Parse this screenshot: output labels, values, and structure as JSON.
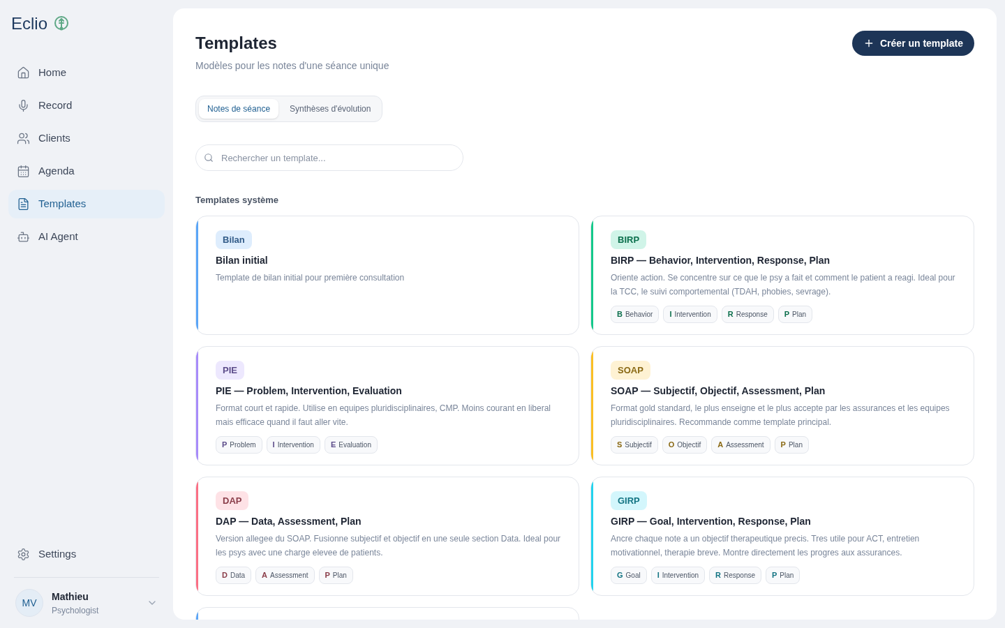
{
  "brand": {
    "name": "Eclio"
  },
  "nav": [
    {
      "label": "Home",
      "kind": "home",
      "selected": false
    },
    {
      "label": "Record",
      "kind": "mic",
      "selected": false
    },
    {
      "label": "Clients",
      "kind": "users",
      "selected": false
    },
    {
      "label": "Agenda",
      "kind": "calendar",
      "selected": false
    },
    {
      "label": "Templates",
      "kind": "file",
      "selected": true
    },
    {
      "label": "AI Agent",
      "kind": "bot",
      "selected": false
    }
  ],
  "settings": {
    "label": "Settings"
  },
  "user": {
    "initials": "MV",
    "name": "Mathieu",
    "role": "Psychologist"
  },
  "page": {
    "title": "Templates",
    "subtitle": "Modèles pour les notes d'une séance unique",
    "create_button": "Créer un template"
  },
  "tabs": [
    {
      "label": "Notes de séance",
      "selected": true
    },
    {
      "label": "Synthèses d'évolution",
      "selected": false
    }
  ],
  "search": {
    "placeholder": "Rechercher un template..."
  },
  "section_title": "Templates système",
  "cards": [
    {
      "color": "#5aa5f7",
      "badge": "Bilan",
      "title": "Bilan initial",
      "description": "Template de bilan initial pour première consultation"
    },
    {
      "color": "#14c98a",
      "badge": "BIRP",
      "title": "BIRP — Behavior, Intervention, Response, Plan",
      "description": "Oriente action. Se concentre sur ce que le psy a fait et comment le patient a reagi. Ideal pour la TCC, le suivi comportemental (TDAH, phobies, sevrage).",
      "sections": [
        {
          "letter": "B",
          "label": "Behavior"
        },
        {
          "letter": "I",
          "label": "Intervention"
        },
        {
          "letter": "R",
          "label": "Response"
        },
        {
          "letter": "P",
          "label": "Plan"
        }
      ]
    },
    {
      "color": "#a78bfa",
      "badge": "PIE",
      "title": "PIE — Problem, Intervention, Evaluation",
      "description": "Format court et rapide. Utilise en equipes pluridisciplinaires, CMP. Moins courant en liberal mais efficace quand il faut aller vite.",
      "sections": [
        {
          "letter": "P",
          "label": "Problem"
        },
        {
          "letter": "I",
          "label": "Intervention"
        },
        {
          "letter": "E",
          "label": "Evaluation"
        }
      ]
    },
    {
      "color": "#fbbf24",
      "badge": "SOAP",
      "title": "SOAP — Subjectif, Objectif, Assessment, Plan",
      "description": "Format gold standard, le plus enseigne et le plus accepte par les assurances et les equipes pluridisciplinaires. Recommande comme template principal.",
      "sections": [
        {
          "letter": "S",
          "label": "Subjectif"
        },
        {
          "letter": "O",
          "label": "Objectif"
        },
        {
          "letter": "A",
          "label": "Assessment"
        },
        {
          "letter": "P",
          "label": "Plan"
        }
      ]
    },
    {
      "color": "#fb6f84",
      "badge": "DAP",
      "title": "DAP — Data, Assessment, Plan",
      "description": "Version allegee du SOAP. Fusionne subjectif et objectif en une seule section Data. Ideal pour les psys avec une charge elevee de patients.",
      "sections": [
        {
          "letter": "D",
          "label": "Data"
        },
        {
          "letter": "A",
          "label": "Assessment"
        },
        {
          "letter": "P",
          "label": "Plan"
        }
      ]
    },
    {
      "color": "#22d3ee",
      "badge": "GIRP",
      "title": "GIRP — Goal, Intervention, Response, Plan",
      "description": "Ancre chaque note a un objectif therapeutique precis. Tres utile pour ACT, entretien motivationnel, therapie breve. Montre directement les progres aux assurances.",
      "sections": [
        {
          "letter": "G",
          "label": "Goal"
        },
        {
          "letter": "I",
          "label": "Intervention"
        },
        {
          "letter": "R",
          "label": "Response"
        },
        {
          "letter": "P",
          "label": "Plan"
        }
      ]
    },
    {
      "color": "#5aa5f7"
    }
  ]
}
